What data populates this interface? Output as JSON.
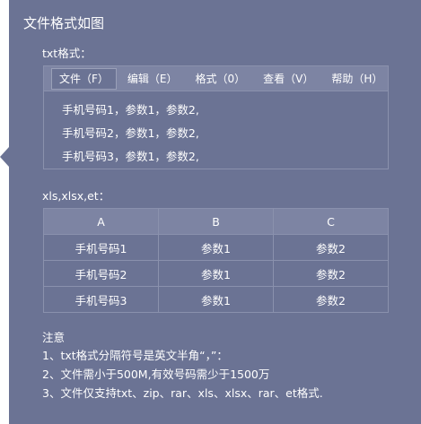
{
  "title": "文件格式如图",
  "txt": {
    "label": "txt格式：",
    "menu": [
      "文件（F）",
      "编辑（E）",
      "格式（0）",
      "查看（V）",
      "帮助（H）"
    ],
    "lines": [
      "手机号码1，参数1，参数2,",
      "手机号码2，参数1，参数2,",
      "手机号码3，参数1，参数2,"
    ]
  },
  "xls": {
    "label": "xls,xlsx,et：",
    "headers": [
      "A",
      "B",
      "C"
    ],
    "rows": [
      [
        "手机号码1",
        "参数1",
        "参数2"
      ],
      [
        "手机号码2",
        "参数1",
        "参数2"
      ],
      [
        "手机号码3",
        "参数1",
        "参数2"
      ]
    ]
  },
  "notes": {
    "title": "注意",
    "items": [
      "1、txt格式分隔符号是英文半角“，”：",
      "2、文件需小于500M,有效号码需少于1500万",
      "3、文件仅支持txt、zip、rar、xls、xlsx、rar、et格式."
    ]
  },
  "colors": {
    "panel": "#6b7394",
    "header": "#7d84a3",
    "border": "#8a91ad",
    "text": "#ffffff"
  }
}
